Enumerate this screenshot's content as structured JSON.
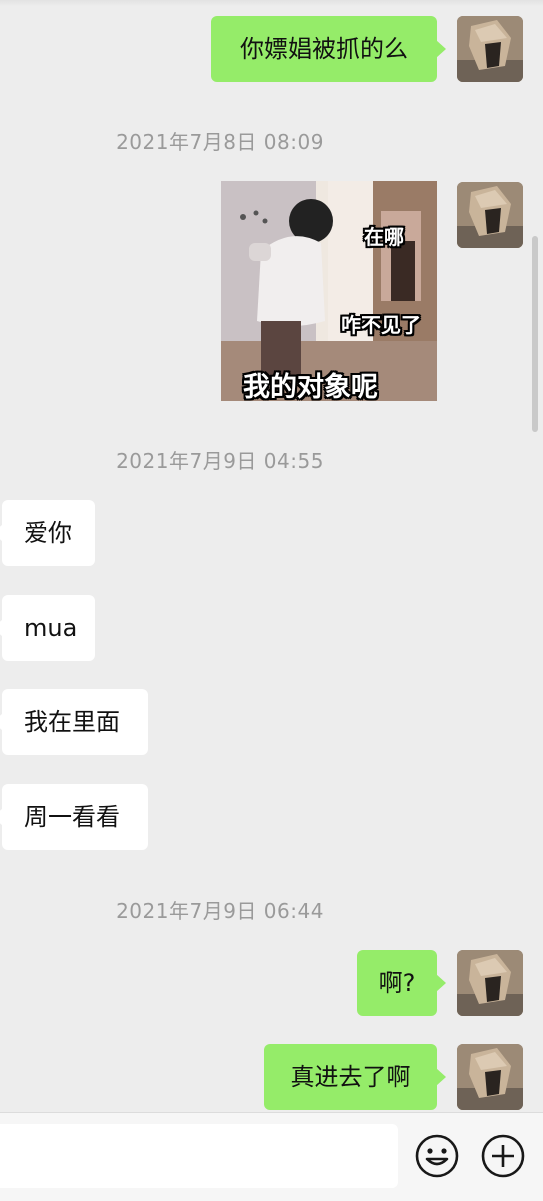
{
  "messages": [
    {
      "type": "text",
      "side": "outgoing",
      "text": "你嫖娼被抓的么"
    },
    {
      "type": "timestamp",
      "text": "2021年7月8日 08:09"
    },
    {
      "type": "sticker",
      "side": "outgoing",
      "captions": [
        "在哪",
        "咋不见了",
        "我的对象呢"
      ]
    },
    {
      "type": "timestamp",
      "text": "2021年7月9日 04:55"
    },
    {
      "type": "text",
      "side": "incoming",
      "text": "爱你"
    },
    {
      "type": "text",
      "side": "incoming",
      "text": "mua"
    },
    {
      "type": "text",
      "side": "incoming",
      "text": "我在里面"
    },
    {
      "type": "text",
      "side": "incoming",
      "text": "周一看看"
    },
    {
      "type": "timestamp",
      "text": "2021年7月9日 06:44"
    },
    {
      "type": "text",
      "side": "outgoing",
      "text": "啊?"
    },
    {
      "type": "text",
      "side": "outgoing",
      "text": "真进去了啊"
    }
  ],
  "input_bar": {
    "icons": [
      "emoji-icon",
      "plus-icon"
    ]
  },
  "colors": {
    "background": "#ededed",
    "outgoing_bubble": "#95ec69",
    "incoming_bubble": "#ffffff",
    "timestamp_text": "#9a9a9a"
  }
}
